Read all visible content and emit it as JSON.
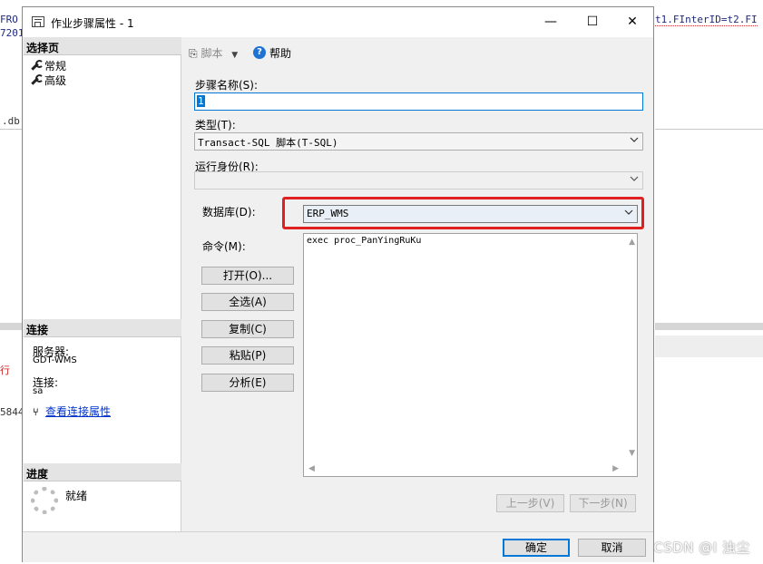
{
  "dialog": {
    "title": "作业步骤属性 - 1",
    "controls": {
      "minimize": "—",
      "maximize": "☐",
      "close": "✕"
    }
  },
  "background": {
    "line1_left": "FRO",
    "line2_left": "7201",
    "line1_right": "t1.FInterID=t2.FI",
    "db_fragment": ".db",
    "left_red": "行",
    "left_num": "5844"
  },
  "left_pane": {
    "select_page_header": "选择页",
    "pages": [
      {
        "label": "常规",
        "icon": "wrench-icon"
      },
      {
        "label": "高级",
        "icon": "wrench-icon"
      }
    ],
    "connection_header": "连接",
    "server_label": "服务器:",
    "server_value": "GDT-WMS",
    "connect_label": "连接:",
    "connect_value": "sa",
    "view_connection_properties": "查看连接属性",
    "progress_header": "进度",
    "progress_status": "就绪"
  },
  "toolbar": {
    "script_label": "脚本",
    "help_label": "帮助"
  },
  "form": {
    "step_name_label": "步骤名称(S):",
    "step_name_value": "1",
    "type_label": "类型(T):",
    "type_value": "Transact-SQL 脚本(T-SQL)",
    "run_as_label": "运行身份(R):",
    "run_as_value": "",
    "database_label": "数据库(D):",
    "database_value": "ERP_WMS",
    "command_label": "命令(M):",
    "command_text": "exec proc_PanYingRuKu"
  },
  "command_buttons": {
    "open": "打开(O)...",
    "select_all": "全选(A)",
    "copy": "复制(C)",
    "paste": "粘贴(P)",
    "parse": "分析(E)"
  },
  "nav_buttons": {
    "previous": "上一步(V)",
    "next": "下一步(N)"
  },
  "footer": {
    "ok": "确定",
    "cancel": "取消",
    "watermark": "CSDN @I 浊尘"
  },
  "colors": {
    "highlight_border": "#e02020",
    "link": "#0033cc",
    "help_icon": "#1e73d2"
  }
}
